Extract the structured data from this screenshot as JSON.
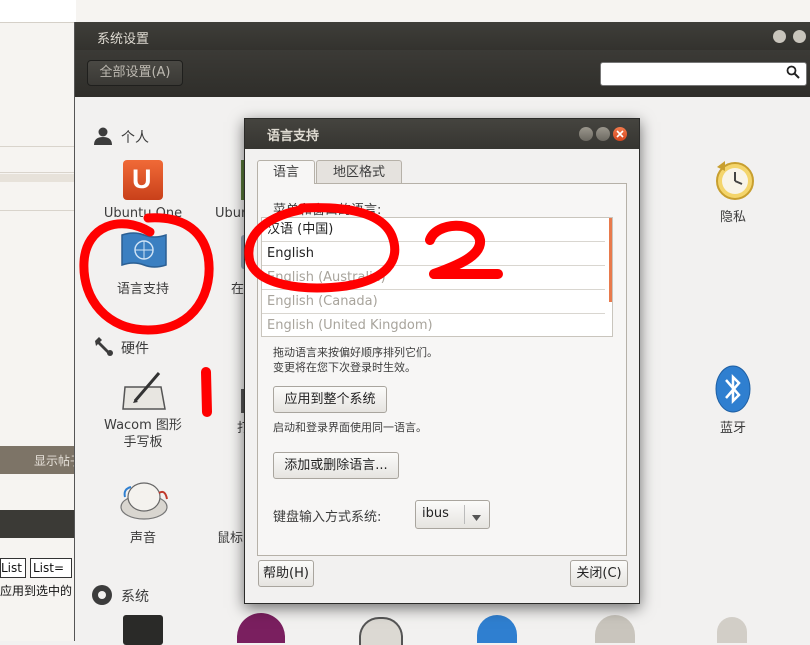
{
  "background": {
    "show_button": "显示帖子",
    "list_btn_1": "List",
    "list_btn_2": "List=",
    "apply_text": "应用到选中的"
  },
  "settings": {
    "title": "系统设置",
    "all_settings": "全部设置(A)",
    "search_placeholder": "",
    "sections": {
      "personal": "个人",
      "hardware": "硬件",
      "system": "系统"
    },
    "tiles": {
      "ubuntu_one": "Ubuntu One",
      "ubuntu_partial": "Ubun",
      "privacy": "隐私",
      "language_support": "语言支持",
      "partial_2": "在",
      "wacom": "Wacom 图形\n手写板",
      "partial_3": "打",
      "bluetooth": "蓝牙",
      "sound": "声音",
      "mouse_partial": "鼠标"
    }
  },
  "dialog": {
    "title": "语言支持",
    "tabs": [
      "语言",
      "地区格式"
    ],
    "menu_label": "菜单和窗口的语言:",
    "languages": [
      {
        "name": "汉语 (中国)",
        "active": true
      },
      {
        "name": "English",
        "active": true
      },
      {
        "name": "English (Australia)",
        "active": false
      },
      {
        "name": "English (Canada)",
        "active": false
      },
      {
        "name": "English (United Kingdom)",
        "active": false
      }
    ],
    "drag_hint_1": "拖动语言来按偏好顺序排列它们。",
    "drag_hint_2": "变更将在您下次登录时生效。",
    "apply_system": "应用到整个系统",
    "apply_hint": "启动和登录界面使用同一语言。",
    "add_remove": "添加或删除语言...",
    "keyboard_label": "键盘输入方式系统:",
    "keyboard_value": "ibus",
    "help": "帮助(H)",
    "close": "关闭(C)"
  },
  "annotations": {
    "mark_1": "1",
    "mark_2": "2"
  },
  "colors": {
    "annotation_red": "#ff0000",
    "ubuntu_orange": "#dd4814",
    "scroll_accent": "#e87a4c"
  }
}
